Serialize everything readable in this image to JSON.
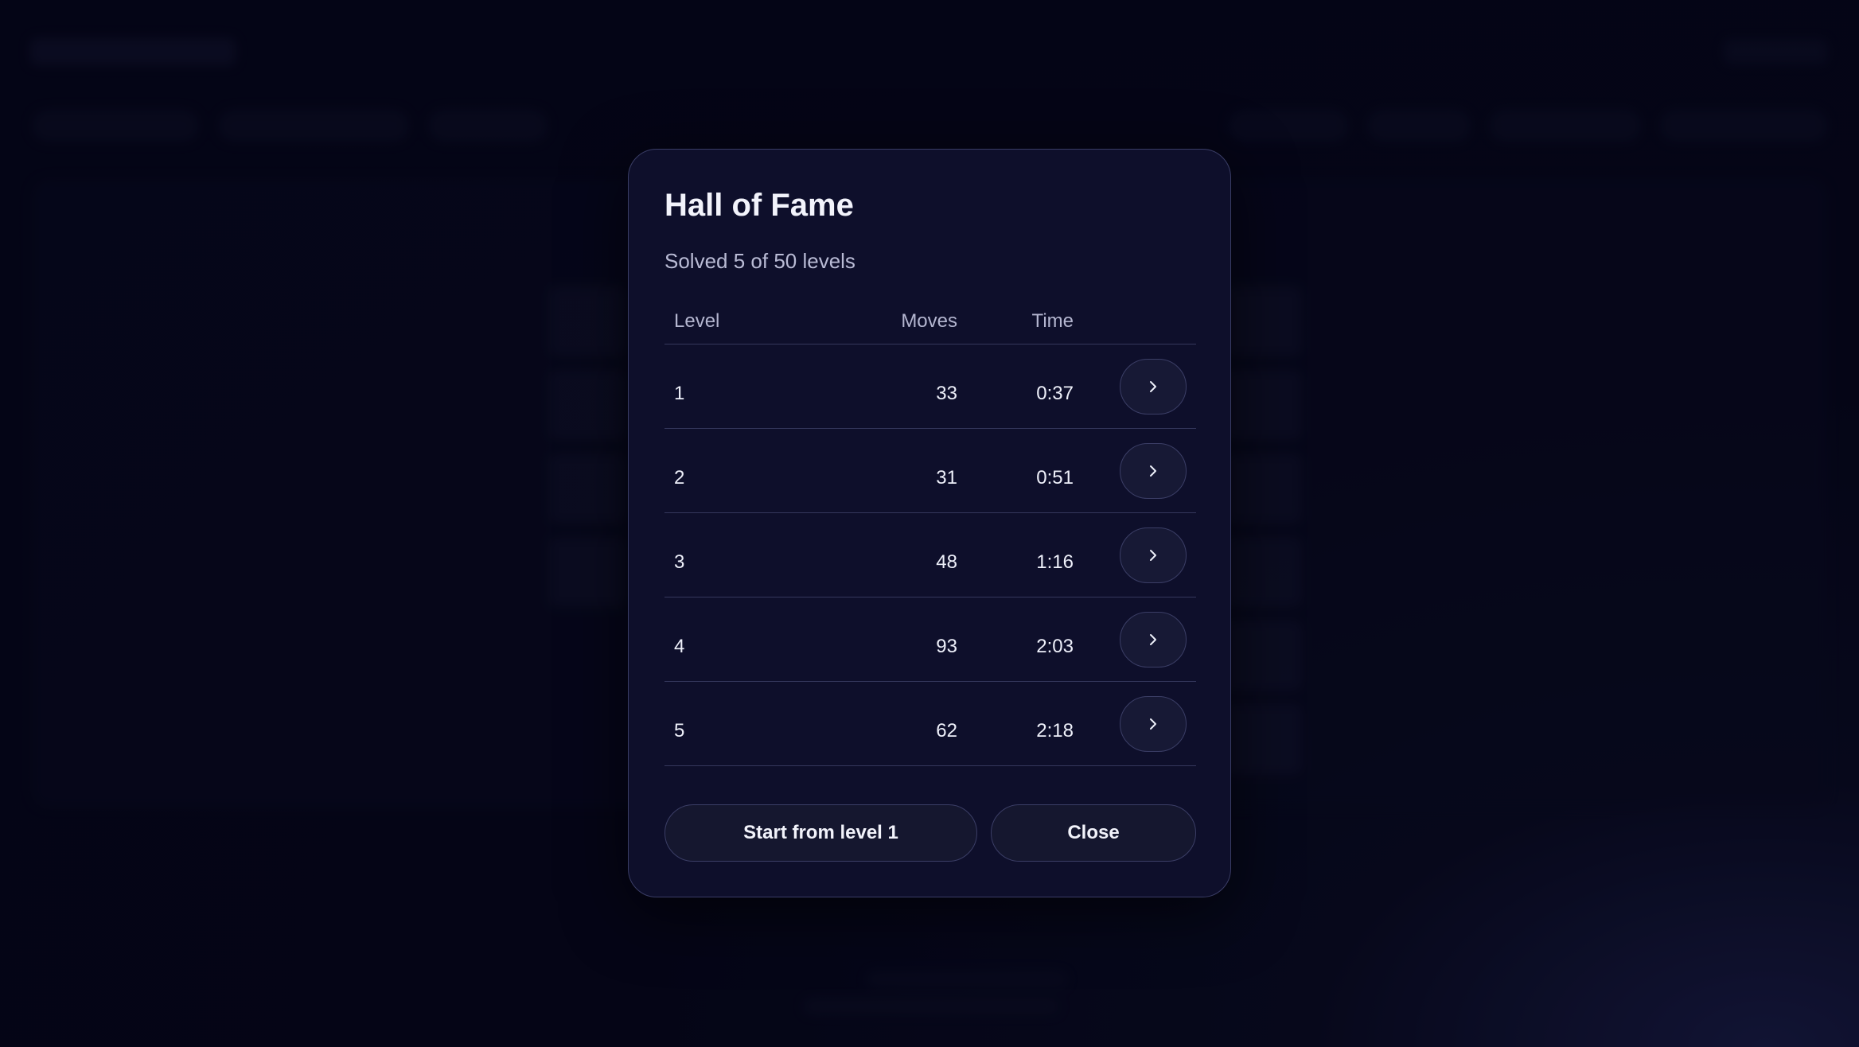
{
  "modal": {
    "title": "Hall of Fame",
    "subtitle": "Solved 5 of 50 levels",
    "columns": {
      "level": "Level",
      "moves": "Moves",
      "time": "Time"
    },
    "rows": [
      {
        "level": "1",
        "moves": "33",
        "time": "0:37",
        "action_icon": "chevron-right-icon"
      },
      {
        "level": "2",
        "moves": "31",
        "time": "0:51",
        "action_icon": "chevron-right-icon"
      },
      {
        "level": "3",
        "moves": "48",
        "time": "1:16",
        "action_icon": "chevron-right-icon"
      },
      {
        "level": "4",
        "moves": "93",
        "time": "2:03",
        "action_icon": "chevron-right-icon"
      },
      {
        "level": "5",
        "moves": "62",
        "time": "2:18",
        "action_icon": "chevron-right-icon"
      }
    ],
    "start_label": "Start from level 1",
    "close_label": "Close"
  },
  "colors": {
    "modal_bg": "#0e0f2b",
    "modal_border": "#3a3d66",
    "page_bg": "#05061a",
    "text_primary": "#f2f3fb",
    "text_muted": "#b4b6d0"
  }
}
